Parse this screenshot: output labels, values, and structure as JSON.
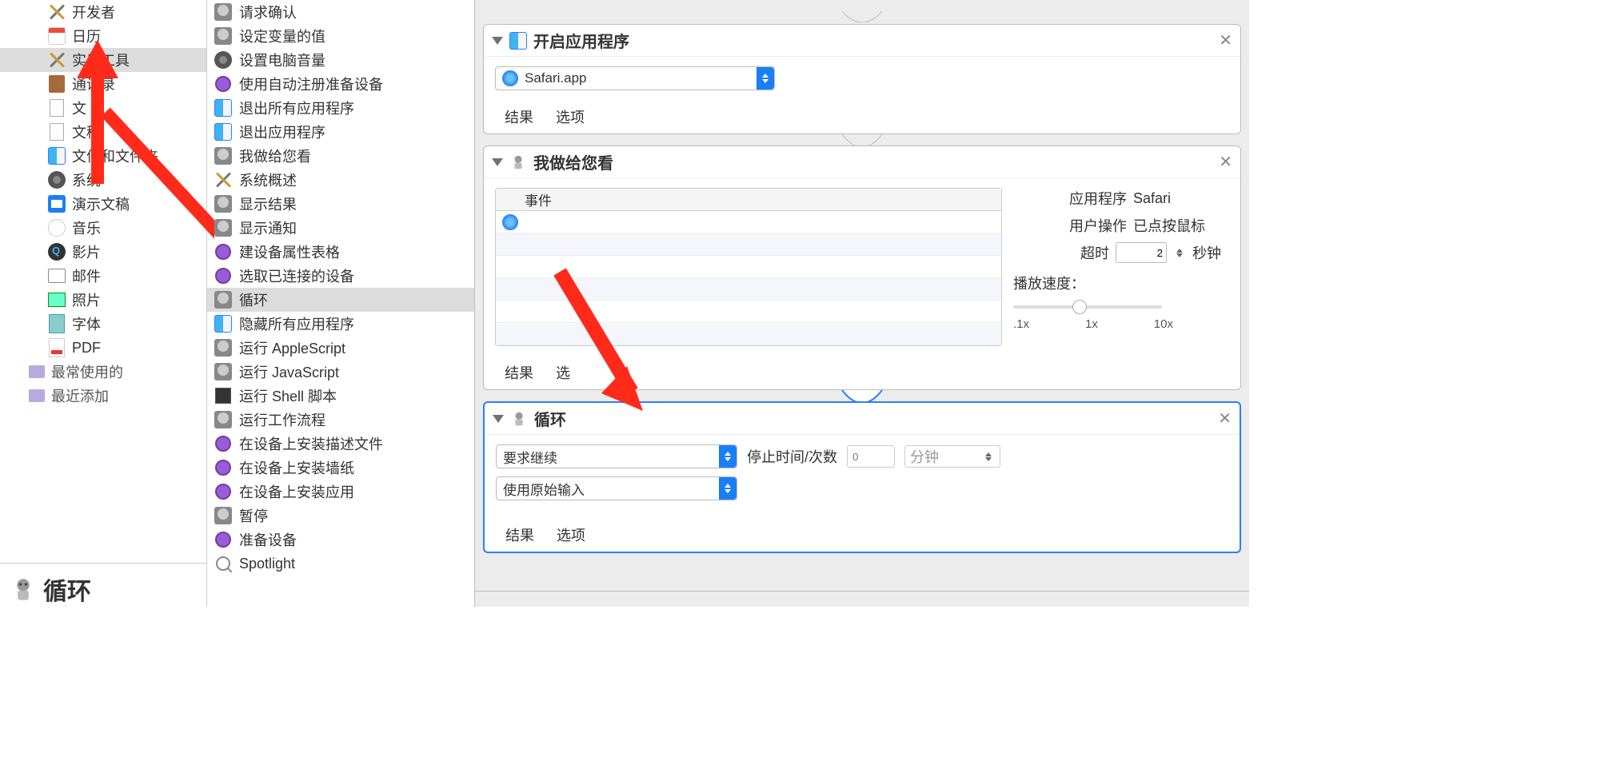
{
  "sidebar_categories": [
    {
      "label": "开发者",
      "icon": "x-tools"
    },
    {
      "label": "日历",
      "icon": "cal-ic"
    },
    {
      "label": "实用工具",
      "icon": "x-tools",
      "selected": true
    },
    {
      "label": "通讯录",
      "icon": "book-ic"
    },
    {
      "label": "文",
      "icon": "page-ic"
    },
    {
      "label": "文稿",
      "icon": "page-ic"
    },
    {
      "label": "文件和文件夹",
      "icon": "finder-ic"
    },
    {
      "label": "系统",
      "icon": "gear-ic"
    },
    {
      "label": "演示文稿",
      "icon": "keynote-ic"
    },
    {
      "label": "音乐",
      "icon": "music-ic"
    },
    {
      "label": "影片",
      "icon": "qt-ic"
    },
    {
      "label": "邮件",
      "icon": "mail-ic"
    },
    {
      "label": "照片",
      "icon": "photo-ic"
    },
    {
      "label": "字体",
      "icon": "font-ic"
    },
    {
      "label": "PDF",
      "icon": "pdf-ic"
    }
  ],
  "sidebar_sections": [
    {
      "label": "最常使用的"
    },
    {
      "label": "最近添加"
    }
  ],
  "footer_title": "循环",
  "actions": [
    {
      "label": "请求确认",
      "icon": "auto-ic"
    },
    {
      "label": "设定变量的值",
      "icon": "auto-ic"
    },
    {
      "label": "设置电脑音量",
      "icon": "gear-ic"
    },
    {
      "label": "使用自动注册准备设备",
      "icon": "purple-ic"
    },
    {
      "label": "退出所有应用程序",
      "icon": "finder-ic"
    },
    {
      "label": "退出应用程序",
      "icon": "finder-ic"
    },
    {
      "label": "我做给您看",
      "icon": "auto-ic"
    },
    {
      "label": "系统概述",
      "icon": "x-tools"
    },
    {
      "label": "显示结果",
      "icon": "auto-ic"
    },
    {
      "label": "显示通知",
      "icon": "auto-ic"
    },
    {
      "label": "建设备属性表格",
      "icon": "purple-ic"
    },
    {
      "label": "选取已连接的设备",
      "icon": "purple-ic"
    },
    {
      "label": "循环",
      "icon": "auto-ic",
      "selected": true
    },
    {
      "label": "隐藏所有应用程序",
      "icon": "finder-ic"
    },
    {
      "label": "运行 AppleScript",
      "icon": "auto-ic"
    },
    {
      "label": "运行 JavaScript",
      "icon": "auto-ic"
    },
    {
      "label": "运行 Shell 脚本",
      "icon": "term-ic"
    },
    {
      "label": "运行工作流程",
      "icon": "auto-ic"
    },
    {
      "label": "在设备上安装描述文件",
      "icon": "purple-ic"
    },
    {
      "label": "在设备上安装墙纸",
      "icon": "purple-ic"
    },
    {
      "label": "在设备上安装应用",
      "icon": "purple-ic"
    },
    {
      "label": "暂停",
      "icon": "auto-ic"
    },
    {
      "label": "准备设备",
      "icon": "purple-ic"
    },
    {
      "label": "Spotlight",
      "icon": "search-ic"
    }
  ],
  "card1": {
    "title": "开启应用程序",
    "app_select": "Safari.app",
    "footer": {
      "results": "结果",
      "options": "选项"
    }
  },
  "card2": {
    "title": "我做给您看",
    "table_header": "事件",
    "kv": {
      "app_label": "应用程序",
      "app_value": "Safari",
      "user_label": "用户操作",
      "user_value": "已点按鼠标",
      "timeout_label": "超时",
      "timeout_value": "2",
      "timeout_unit": "秒钟",
      "speed_label": "播放速度：",
      "ticks": {
        "a": ".1x",
        "b": "1x",
        "c": "10x"
      }
    },
    "footer": {
      "results": "结果",
      "options": "选"
    }
  },
  "card3": {
    "title": "循环",
    "mode_select": "要求继续",
    "stop_label": "停止时间/次数",
    "stop_value_placeholder": "0",
    "unit_select": "分钟",
    "input_select": "使用原始输入",
    "footer": {
      "results": "结果",
      "options": "选项"
    }
  }
}
